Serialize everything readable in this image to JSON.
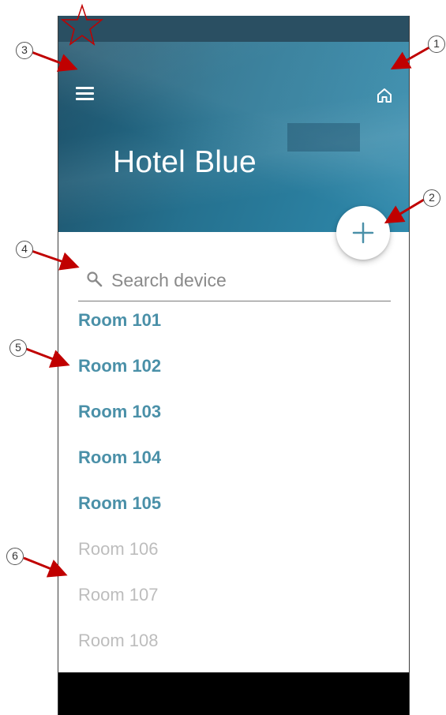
{
  "header": {
    "title": "Hotel Blue"
  },
  "search": {
    "placeholder": "Search device"
  },
  "rooms": [
    {
      "label": "Room 101",
      "state": "active"
    },
    {
      "label": "Room 102",
      "state": "active"
    },
    {
      "label": "Room 103",
      "state": "active"
    },
    {
      "label": "Room 104",
      "state": "active"
    },
    {
      "label": "Room 105",
      "state": "active"
    },
    {
      "label": "Room 106",
      "state": "inactive"
    },
    {
      "label": "Room 107",
      "state": "inactive"
    },
    {
      "label": "Room 108",
      "state": "inactive"
    }
  ],
  "annotations": {
    "callouts": [
      "1",
      "2",
      "3",
      "4",
      "5",
      "6"
    ]
  },
  "icons": {
    "menu": "menu-icon",
    "home": "home-icon",
    "add": "plus-icon",
    "search": "search-icon",
    "star": "star-icon"
  },
  "colors": {
    "header": "#25718f",
    "status_bar": "#2a4f62",
    "room_active": "#4a90a8",
    "room_inactive": "#bdbdbd",
    "fab_plus": "#4a90a8",
    "annotation_arrow": "#c00000"
  }
}
